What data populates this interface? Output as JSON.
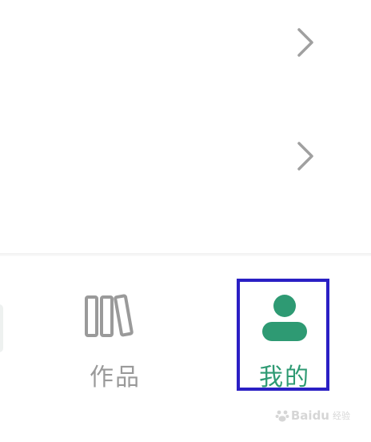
{
  "list": {
    "rows": [
      {
        "chevron_icon": "chevron-right-icon"
      },
      {
        "chevron_icon": "chevron-right-icon"
      }
    ]
  },
  "tabbar": {
    "tabs": [
      {
        "label": "作品",
        "icon": "books-icon",
        "selected": false
      },
      {
        "label": "我的",
        "icon": "person-icon",
        "selected": true
      }
    ]
  },
  "colors": {
    "accent": "#2e9a73",
    "inactive": "#9a9a9a",
    "highlight_box": "#2a1fc4",
    "chevron": "#a0a0a0"
  },
  "watermark": {
    "text": "Baidu",
    "sub": "经验"
  }
}
